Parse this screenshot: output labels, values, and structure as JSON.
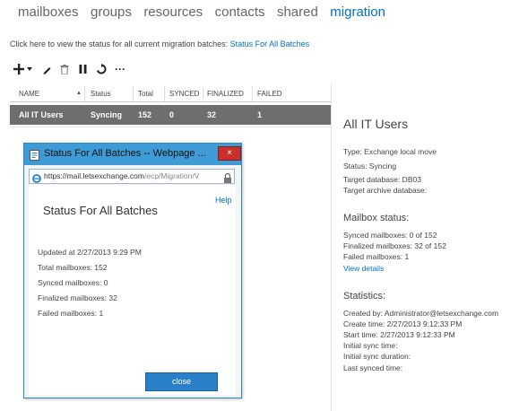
{
  "nav": {
    "items": [
      "mailboxes",
      "groups",
      "resources",
      "contacts",
      "shared",
      "migration"
    ]
  },
  "info": {
    "text": "Click here to view the status for all current migration batches: ",
    "link": "Status For All Batches"
  },
  "toolbar": {
    "icons": [
      "add-icon",
      "dropdown-arrow-icon",
      "edit-icon",
      "delete-icon",
      "pause-icon",
      "refresh-icon",
      "more-icon"
    ],
    "more_label": "···"
  },
  "table": {
    "columns": [
      "NAME",
      "Status",
      "Total",
      "SYNCED",
      "FINALIZED",
      "FAILED"
    ],
    "sort_indicator": "▲",
    "rows": [
      {
        "name": "All IT Users",
        "status": "Syncing",
        "total": "152",
        "synced": "0",
        "finalized": "32",
        "failed": "1"
      }
    ]
  },
  "details": {
    "title": "All IT Users",
    "type": "Type: Exchange local move",
    "status": "Status: Syncing",
    "target_db": "Target database: DB03",
    "target_archive_db": "Target archive database:",
    "mailbox_status_heading": "Mailbox status:",
    "synced": "Synced mailboxes: 0 of 152",
    "finalized": "Finalized mailboxes: 32 of 152",
    "failed": "Failed mailboxes: 1",
    "view_details": "View details",
    "statistics_heading": "Statistics:",
    "created_by": "Created by: Administrator@letsexchange.com",
    "create_time": "Create time: 2/27/2013 9:12:33 PM",
    "start_time": "Start time: 2/27/2013 9:12:33 PM",
    "initial_sync_time": "Initial sync time:",
    "initial_sync_duration": "Initial sync duration:",
    "last_synced_time": "Last synced time:"
  },
  "popup": {
    "title": "Status For All Batches -- Webpage ...",
    "close_x": "×",
    "url_main": "https://mail.letsexchange.com",
    "url_rest": "/ecp/Migration/V",
    "help": "Help",
    "heading": "Status For All Batches",
    "updated": "Updated at 2/27/2013 9:29 PM",
    "total": "Total mailboxes: 152",
    "synced": "Synced mailboxes: 0",
    "finalized": "Finalized mailboxes: 32",
    "failed": "Failed mailboxes: 1",
    "close_button": "close"
  },
  "colors": {
    "accent": "#0072c6",
    "selected_row": "#6e6e6e",
    "popup_titlebar": "#3e9bd6",
    "close_red": "#c9302c"
  }
}
